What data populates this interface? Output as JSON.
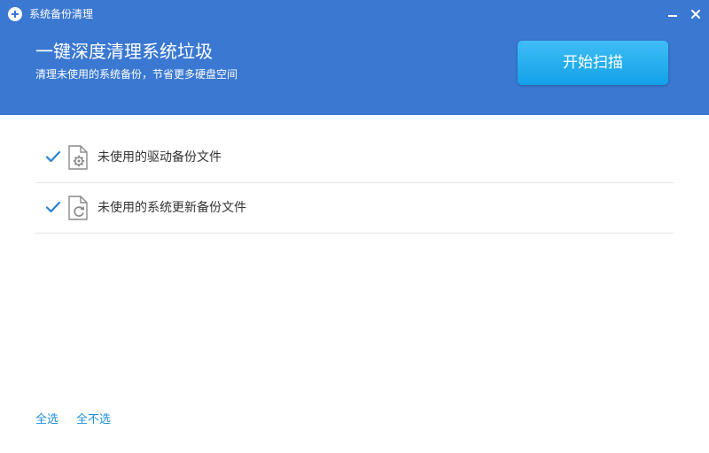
{
  "window": {
    "title": "系统备份清理",
    "app_icon": "plus-circle-icon",
    "minimize_icon": "minimize-icon",
    "close_icon": "close-icon"
  },
  "header": {
    "title": "一键深度清理系统垃圾",
    "subtitle": "清理未使用的系统备份，节省更多硬盘空间",
    "scan_button_label": "开始扫描"
  },
  "items": [
    {
      "label": "未使用的驱动备份文件",
      "checked": true,
      "icon": "driver-gear-file-icon"
    },
    {
      "label": "未使用的系统更新备份文件",
      "checked": true,
      "icon": "update-refresh-file-icon"
    }
  ],
  "footer": {
    "select_all_label": "全选",
    "select_none_label": "全不选"
  },
  "colors": {
    "header_bg": "#3a78d2",
    "scan_button": "#1aa6ea",
    "link": "#1e8fd8",
    "checkmark": "#2a7fd4"
  }
}
